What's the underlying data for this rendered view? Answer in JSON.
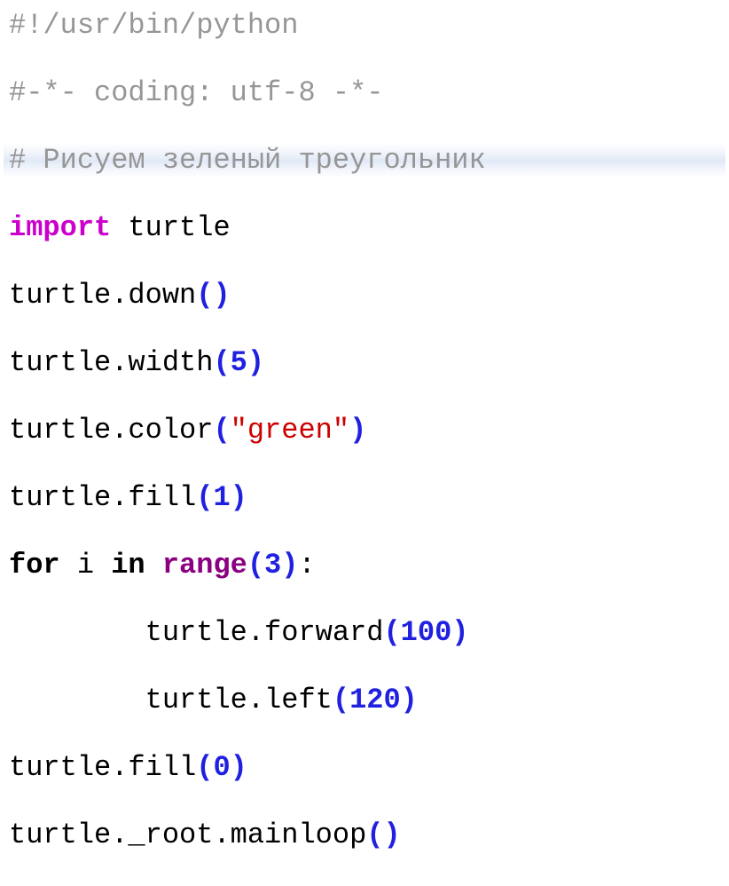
{
  "code": {
    "shebang": "#!/usr/bin/python",
    "encoding": "#-*- coding: utf-8 -*-",
    "comment": "# Рисуем зеленый треугольник",
    "import_kw": "import",
    "turtle": "turtle",
    "down": "down",
    "width": "width",
    "width_arg": "5",
    "color": "color",
    "color_arg": "\"green\"",
    "fill": "fill",
    "fill_arg1": "1",
    "for_kw": "for",
    "loop_var": "i",
    "in_kw": "in",
    "range": "range",
    "range_arg": "3",
    "forward": "forward",
    "forward_arg": "100",
    "left": "left",
    "left_arg": "120",
    "fill_arg0": "0",
    "root": "_root",
    "mainloop": "mainloop",
    "dot": ".",
    "lpar": "(",
    "rpar": ")",
    "colon": ":",
    "space": " "
  }
}
